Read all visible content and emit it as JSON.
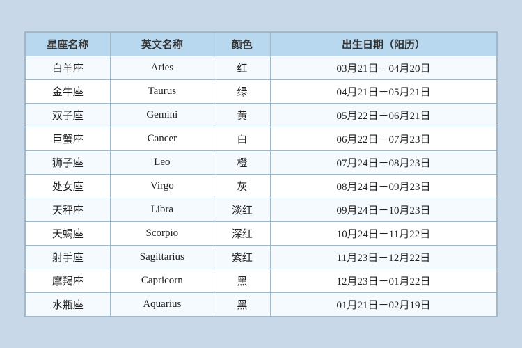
{
  "table": {
    "headers": [
      "星座名称",
      "英文名称",
      "颜色",
      "出生日期（阳历）"
    ],
    "rows": [
      {
        "cn": "白羊座",
        "en": "Aries",
        "color": "红",
        "date": "03月21日－04月20日"
      },
      {
        "cn": "金牛座",
        "en": "Taurus",
        "color": "绿",
        "date": "04月21日－05月21日"
      },
      {
        "cn": "双子座",
        "en": "Gemini",
        "color": "黄",
        "date": "05月22日－06月21日"
      },
      {
        "cn": "巨蟹座",
        "en": "Cancer",
        "color": "白",
        "date": "06月22日－07月23日"
      },
      {
        "cn": "狮子座",
        "en": "Leo",
        "color": "橙",
        "date": "07月24日－08月23日"
      },
      {
        "cn": "处女座",
        "en": "Virgo",
        "color": "灰",
        "date": "08月24日－09月23日"
      },
      {
        "cn": "天秤座",
        "en": "Libra",
        "color": "淡红",
        "date": "09月24日－10月23日"
      },
      {
        "cn": "天蝎座",
        "en": "Scorpio",
        "color": "深红",
        "date": "10月24日－11月22日"
      },
      {
        "cn": "射手座",
        "en": "Sagittarius",
        "color": "紫红",
        "date": "11月23日－12月22日"
      },
      {
        "cn": "摩羯座",
        "en": "Capricorn",
        "color": "黑",
        "date": "12月23日－01月22日"
      },
      {
        "cn": "水瓶座",
        "en": "Aquarius",
        "color": "黑",
        "date": "01月21日－02月19日"
      }
    ]
  }
}
